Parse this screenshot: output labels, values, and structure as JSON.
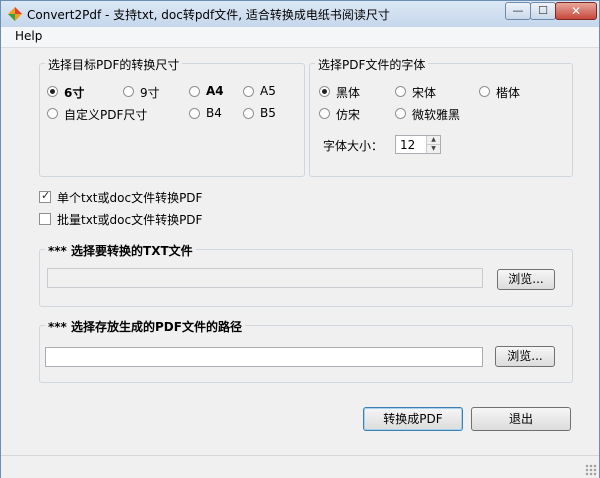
{
  "window": {
    "title": "Convert2Pdf - 支持txt, doc转pdf文件, 适合转换成电纸书阅读尺寸",
    "min_glyph": "—",
    "max_glyph": "☐",
    "close_glyph": "✕"
  },
  "menu": {
    "help": "Help"
  },
  "size_group": {
    "title": "选择目标PDF的转换尺寸",
    "options": [
      {
        "label": "6寸",
        "selected": true
      },
      {
        "label": "9寸",
        "selected": false
      },
      {
        "label": "A4",
        "selected": false
      },
      {
        "label": "A5",
        "selected": false
      },
      {
        "label": "自定义PDF尺寸",
        "selected": false
      },
      {
        "label": "B4",
        "selected": false
      },
      {
        "label": "B5",
        "selected": false
      }
    ]
  },
  "font_group": {
    "title": "选择PDF文件的字体",
    "options": [
      {
        "label": "黑体",
        "selected": true
      },
      {
        "label": "宋体",
        "selected": false
      },
      {
        "label": "楷体",
        "selected": false
      },
      {
        "label": "仿宋",
        "selected": false
      },
      {
        "label": "微软雅黑",
        "selected": false
      }
    ],
    "size_label": "字体大小：",
    "size_value": "12"
  },
  "single_check": {
    "label": "单个txt或doc文件转换PDF",
    "checked": true
  },
  "batch_check": {
    "label": "批量txt或doc文件转换PDF",
    "checked": false
  },
  "source_group": {
    "title": "*** 选择要转换的TXT文件",
    "value": "",
    "browse": "浏览..."
  },
  "dest_group": {
    "title": "*** 选择存放生成的PDF文件的路径",
    "value": "",
    "browse": "浏览..."
  },
  "actions": {
    "convert": "转换成PDF",
    "exit": "退出"
  }
}
